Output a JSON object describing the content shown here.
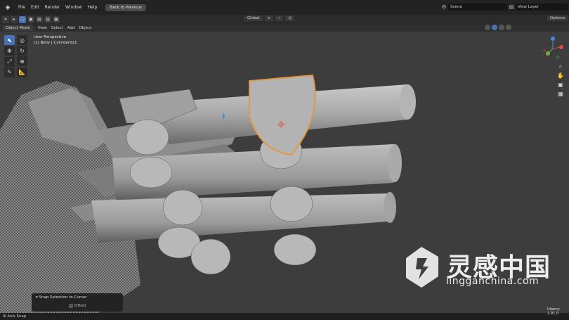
{
  "app": {
    "logo_icon": "blender-logo-icon"
  },
  "topbar": {
    "menu": [
      "File",
      "Edit",
      "Render",
      "Window",
      "Help"
    ],
    "back_button": "Back to Previous",
    "scene_value": "Scene",
    "view_layer_value": "View Layer"
  },
  "toolbar2": {
    "orientation": "Global",
    "options": "Options"
  },
  "header": {
    "mode": "Object Mode",
    "menu": [
      "View",
      "Select",
      "Add",
      "Object"
    ]
  },
  "viewport": {
    "perspective": "User Perspective",
    "object_info": "(1) Belly | Cylinder021"
  },
  "redo_panel": {
    "title": "Snap Selection to Cursor",
    "offset_label": "Offset"
  },
  "statusbar": {
    "left_text": "Axis Snap"
  },
  "watermark": {
    "chinese": "灵感中国",
    "url": "lingganchina.com"
  },
  "udemy": {
    "label": "Udemy",
    "sub": "2.91.0"
  },
  "colors": {
    "accent": "#4772b3",
    "selection_outline": "#e8953a",
    "topbar_bg": "#232323",
    "viewport_bg": "#3d3d3d"
  }
}
